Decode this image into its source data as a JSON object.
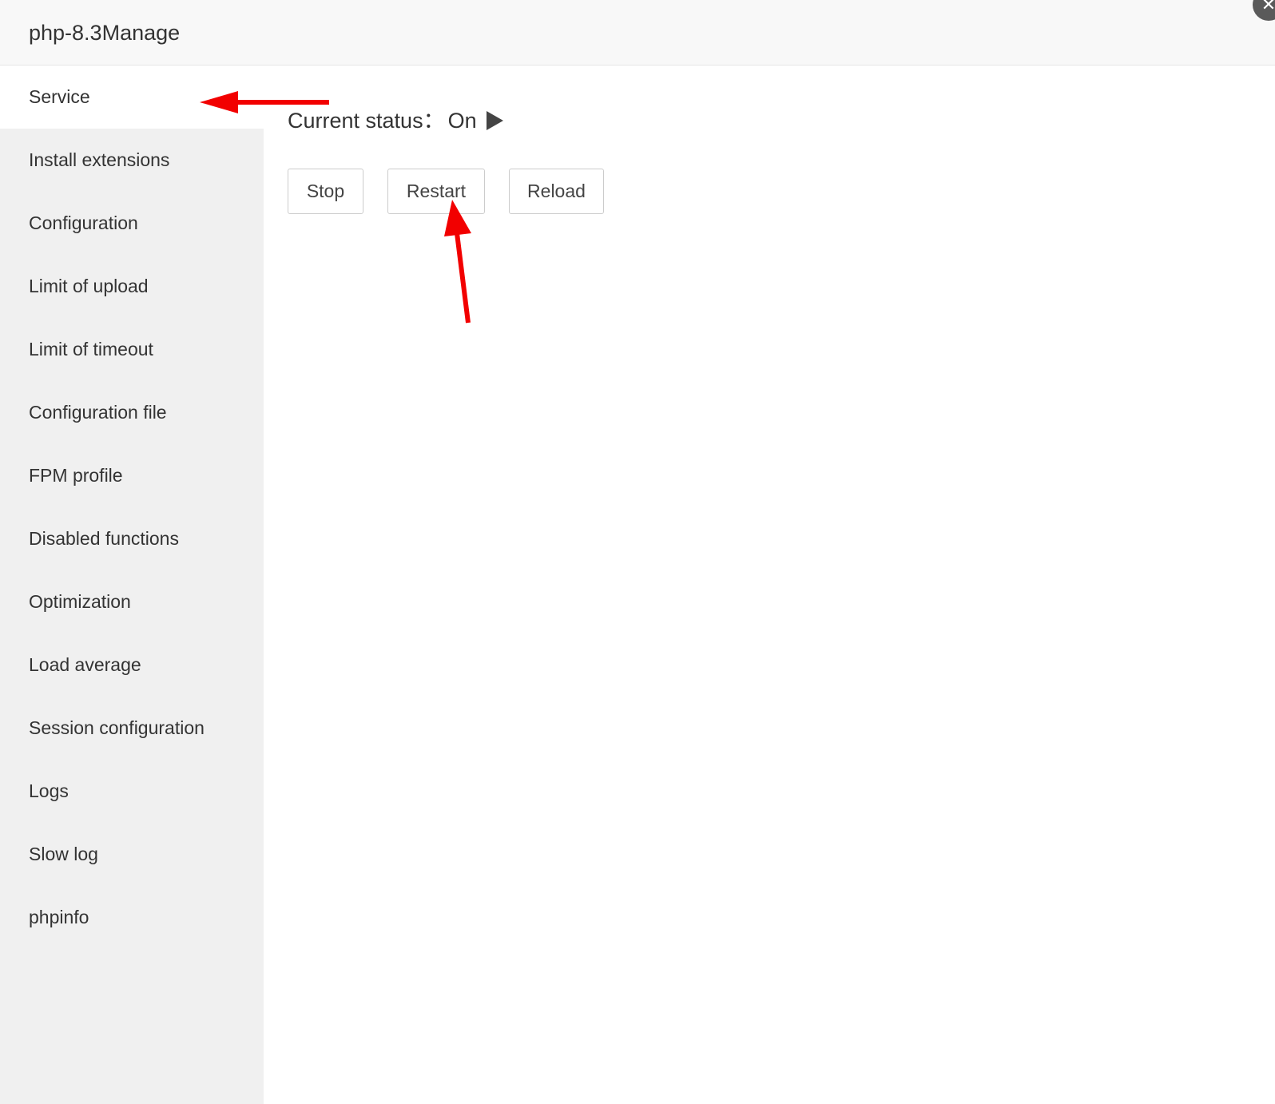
{
  "window": {
    "title": "php-8.3Manage",
    "close_glyph": "✕"
  },
  "sidebar": {
    "items": [
      {
        "label": "Service",
        "active": true
      },
      {
        "label": "Install extensions"
      },
      {
        "label": "Configuration"
      },
      {
        "label": "Limit of upload"
      },
      {
        "label": "Limit of timeout"
      },
      {
        "label": "Configuration file"
      },
      {
        "label": "FPM profile"
      },
      {
        "label": "Disabled functions"
      },
      {
        "label": "Optimization"
      },
      {
        "label": "Load average"
      },
      {
        "label": "Session configuration"
      },
      {
        "label": "Logs"
      },
      {
        "label": "Slow log"
      },
      {
        "label": "phpinfo"
      }
    ]
  },
  "service": {
    "status_label": "Current status：",
    "status_value": "On",
    "status_icon": "play-icon",
    "buttons": {
      "stop": "Stop",
      "restart": "Restart",
      "reload": "Reload"
    }
  },
  "colors": {
    "annotation_arrow": "#f20000",
    "sidebar_bg": "#f0f0f0",
    "status_icon": "#444444"
  }
}
